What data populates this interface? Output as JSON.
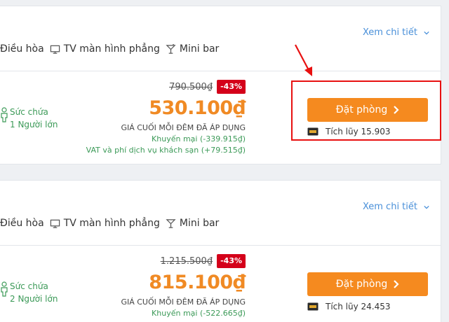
{
  "details_label": "Xem chi tiết",
  "book_label": "Đặt phòng",
  "final_price_label": "GIÁ CUỐI MỖI ĐÊM ĐÃ ÁP DỤNG",
  "occupancy_label": "Sức chứa",
  "amenities": [
    {
      "label": "Điều hòa",
      "icon": "air-conditioner-icon"
    },
    {
      "label": "TV màn hình phẳng",
      "icon": "tv-icon"
    },
    {
      "label": "Mini bar",
      "icon": "cocktail-icon"
    }
  ],
  "rooms": [
    {
      "original_price": "790.500₫",
      "discount": "-43%",
      "price": "530.100₫",
      "promo": "Khuyến mại (-339.915₫)",
      "vat": "VAT và phí dịch vụ khách sạn (+79.515₫)",
      "capacity": "1 Người lớn",
      "points": "Tích lũy 15.903"
    },
    {
      "original_price": "1.215.500₫",
      "discount": "-43%",
      "price": "815.100₫",
      "promo": "Khuyến mại (-522.665₫)",
      "capacity": "2 Người lớn",
      "points": "Tích lũy 24.453"
    }
  ],
  "colors": {
    "accent": "#f58a1f",
    "price": "#f08a24",
    "discount": "#d4001a",
    "green": "#3c9a58",
    "link": "#4a90d9",
    "annotation": "#e81010"
  }
}
